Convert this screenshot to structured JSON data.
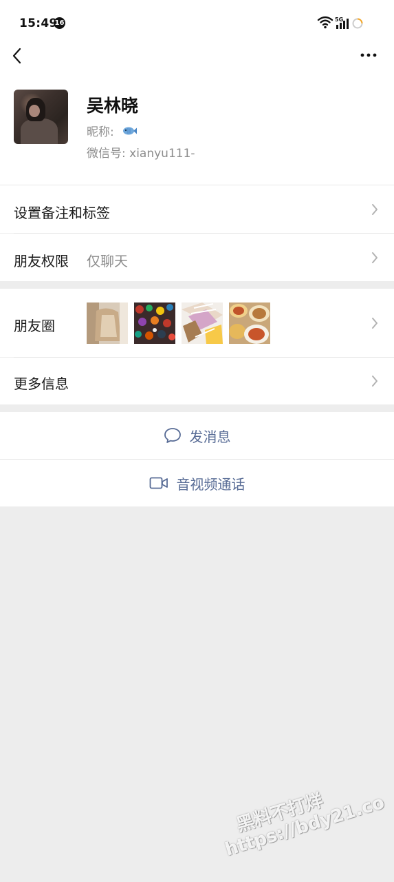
{
  "status_bar": {
    "time": "15:49",
    "notification_count": "16",
    "network_label": "5G"
  },
  "nav": {
    "back_icon": "chevron-left-icon",
    "more_icon": "more-dots-icon"
  },
  "profile": {
    "name": "吴林晓",
    "nickname_label": "昵称:",
    "nickname_icon": "fish-icon",
    "wechat_id_label": "微信号:",
    "wechat_id": "xianyu111-"
  },
  "cells": {
    "remark_tags": "设置备注和标签",
    "friend_permissions": "朋友权限",
    "friend_permissions_value": "仅聊天",
    "moments": "朋友圈",
    "more_info": "更多信息"
  },
  "actions": {
    "send_message": "发消息",
    "video_call": "音视频通话"
  },
  "watermark": {
    "line1": "黑料不打烊",
    "line2": "https://bdy21.co"
  },
  "colors": {
    "link_blue": "#576b95",
    "background": "#ededed",
    "card": "#ffffff",
    "secondary_text": "#8c8c8c"
  }
}
